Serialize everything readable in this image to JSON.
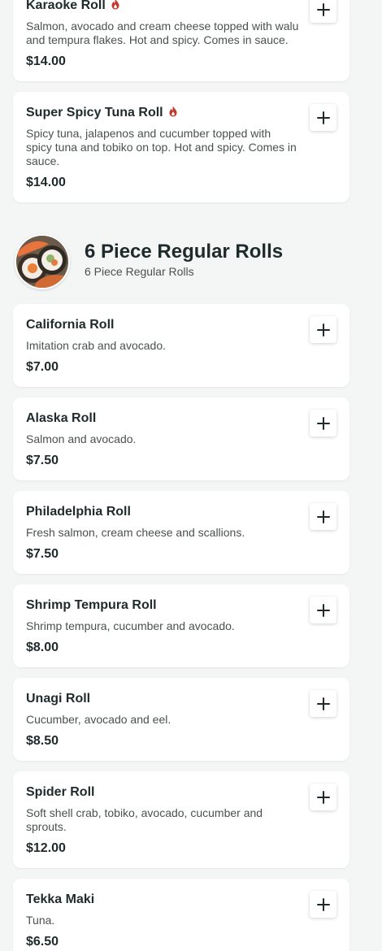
{
  "colors": {
    "background": "#f4f5f5",
    "card": "#ffffff",
    "text": "#1f2a2a",
    "muted": "#4a5050",
    "spicy": "#c0392b"
  },
  "items_prev": [
    {
      "name": "Karaoke Roll",
      "spicy": true,
      "description": "Salmon, avocado and cream cheese topped with walu and tempura flakes. Hot and spicy. Comes in sauce.",
      "price": "$14.00"
    },
    {
      "name": "Super Spicy Tuna Roll",
      "spicy": true,
      "description": "Spicy tuna, jalapenos and cucumber topped with spicy tuna and tobiko on top. Hot and spicy. Comes in sauce.",
      "price": "$14.00"
    }
  ],
  "section": {
    "title": "6 Piece Regular Rolls",
    "subtitle": "6 Piece Regular Rolls"
  },
  "items": [
    {
      "name": "California Roll",
      "description": "Imitation crab and avocado.",
      "price": "$7.00"
    },
    {
      "name": "Alaska Roll",
      "description": "Salmon and avocado.",
      "price": "$7.50"
    },
    {
      "name": "Philadelphia Roll",
      "description": "Fresh salmon, cream cheese and scallions.",
      "price": "$7.50"
    },
    {
      "name": "Shrimp Tempura Roll",
      "description": "Shrimp tempura, cucumber and avocado.",
      "price": "$8.00"
    },
    {
      "name": "Unagi Roll",
      "description": "Cucumber, avocado and eel.",
      "price": "$8.50"
    },
    {
      "name": "Spider Roll",
      "description": "Soft shell crab, tobiko, avocado, cucumber and sprouts.",
      "price": "$12.00"
    },
    {
      "name": "Tekka Maki",
      "description": "Tuna.",
      "price": "$6.50"
    }
  ],
  "icons": {
    "add": "plus-icon",
    "spicy": "flame-icon"
  }
}
